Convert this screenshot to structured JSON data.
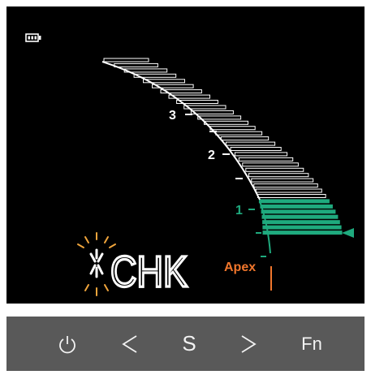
{
  "display": {
    "battery_icon": "battery-icon",
    "scale_labels": [
      "3",
      "2",
      "1"
    ],
    "apex_label": "Apex",
    "status_text": "CHK",
    "blink_icon": "blinking-asterisk-icon",
    "pointer_icon": "left-pointer-icon",
    "level": 0.22
  },
  "controls": {
    "power": {
      "icon": "power-icon"
    },
    "prev": {
      "icon": "chevron-left-icon"
    },
    "select": {
      "label": "S"
    },
    "next": {
      "icon": "chevron-right-icon"
    },
    "function": {
      "label": "Fn"
    }
  },
  "colors": {
    "screen_bg": "#000000",
    "white": "#ffffff",
    "green": "#1faa7e",
    "orange": "#f0762c",
    "panel": "#595959"
  }
}
